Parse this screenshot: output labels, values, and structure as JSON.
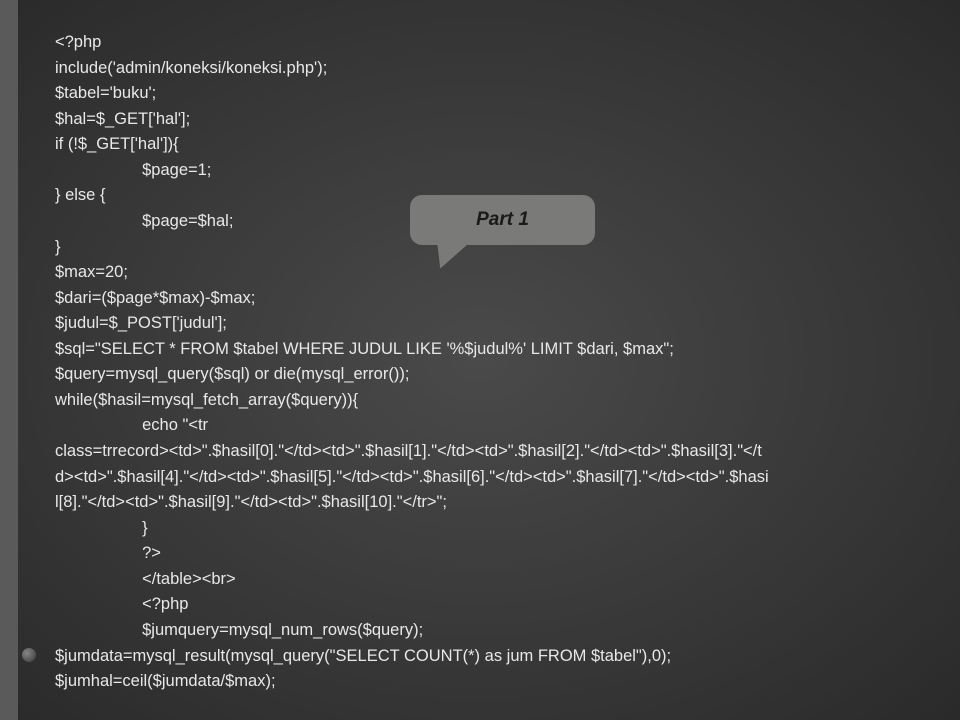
{
  "callout": {
    "label": "Part 1"
  },
  "code": {
    "lines": [
      "<?php",
      "include('admin/koneksi/koneksi.php');",
      "$tabel='buku';",
      "$hal=$_GET['hal'];",
      "if (!$_GET['hal']){",
      "                   $page=1;",
      "} else {",
      "                   $page=$hal;",
      "}",
      "$max=20;",
      "$dari=($page*$max)-$max;",
      "$judul=$_POST['judul'];",
      "$sql=\"SELECT * FROM $tabel WHERE JUDUL LIKE '%$judul%' LIMIT $dari, $max\";",
      "$query=mysql_query($sql) or die(mysql_error());",
      "while($hasil=mysql_fetch_array($query)){",
      "                   echo \"<tr",
      "class=trrecord><td>\".$hasil[0].\"</td><td>\".$hasil[1].\"</td><td>\".$hasil[2].\"</td><td>\".$hasil[3].\"</t",
      "d><td>\".$hasil[4].\"</td><td>\".$hasil[5].\"</td><td>\".$hasil[6].\"</td><td>\".$hasil[7].\"</td><td>\".$hasi",
      "l[8].\"</td><td>\".$hasil[9].\"</td><td>\".$hasil[10].\"</tr>\";",
      "                   }",
      "                   ?>",
      "                   </table><br>",
      "                   <?php",
      "                   $jumquery=mysql_num_rows($query);",
      "$jumdata=mysql_result(mysql_query(\"SELECT COUNT(*) as jum FROM $tabel\"),0);",
      "$jumhal=ceil($jumdata/$max);"
    ]
  }
}
